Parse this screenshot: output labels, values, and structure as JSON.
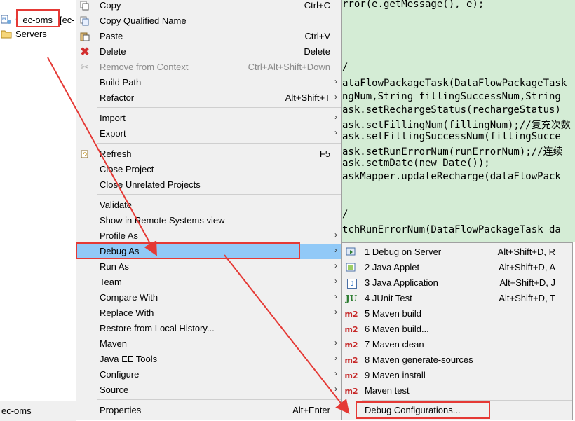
{
  "explorer": {
    "project_name": "ec-oms",
    "project_suffix": "[ec-",
    "servers_label": "Servers",
    "status_text": "ec-oms"
  },
  "editor": {
    "lines": [
      {
        "pre": "",
        "parts": [
          [
            "t",
            "rror(e.getMessage(), e);"
          ]
        ]
      },
      {
        "pre": "",
        "parts": [
          [
            "t",
            "/"
          ]
        ]
      },
      {
        "pre": "",
        "parts": [
          [
            "t",
            "ataFlowPackageTask(DataFlowPackageTask"
          ]
        ]
      },
      {
        "pre": "",
        "parts": [
          [
            "t",
            "ngNum,String fillingSuccessNum,String"
          ]
        ]
      },
      {
        "pre": "",
        "parts": [
          [
            "t",
            "ask.setRechargeStatus(rechargeStatus)"
          ]
        ]
      },
      {
        "pre": "",
        "parts": [
          [
            "t",
            "ask.setFillingNum(fillingNum);//复充次数"
          ]
        ]
      },
      {
        "pre": "",
        "parts": [
          [
            "t",
            "ask.setFillingSuccessNum(fillingSucce"
          ]
        ]
      },
      {
        "pre": "",
        "parts": [
          [
            "t",
            "ask.setRunErrorNum(runErrorNum);//连续"
          ]
        ]
      },
      {
        "pre": "",
        "parts": [
          [
            "t",
            "ask.setmDate(new Date());"
          ]
        ]
      },
      {
        "pre": "",
        "parts": [
          [
            "t",
            "askMapper.updateRecharge(dataFlowPack"
          ]
        ]
      },
      {
        "pre": "",
        "parts": [
          [
            "t",
            "/"
          ]
        ]
      },
      {
        "pre": "",
        "parts": [
          [
            "t",
            "tchRunErrorNum(DataFlowPackageTask da"
          ]
        ]
      }
    ]
  },
  "menu": {
    "items": [
      {
        "label": "Copy",
        "shortcut": "Ctrl+C",
        "icon": "copy-icon"
      },
      {
        "label": "Copy Qualified Name",
        "shortcut": "",
        "icon": "copy-qualified-icon"
      },
      {
        "label": "Paste",
        "shortcut": "Ctrl+V",
        "icon": "paste-icon"
      },
      {
        "label": "Delete",
        "shortcut": "Delete",
        "icon": "delete-icon"
      },
      {
        "label": "Remove from Context",
        "shortcut": "Ctrl+Alt+Shift+Down",
        "icon": "remove-context-icon"
      },
      {
        "label": "Build Path",
        "shortcut": "",
        "icon": ""
      },
      {
        "label": "Refactor",
        "shortcut": "Alt+Shift+T",
        "icon": ""
      },
      {
        "label": "Import",
        "shortcut": "",
        "icon": ""
      },
      {
        "label": "Export",
        "shortcut": "",
        "icon": ""
      },
      {
        "label": "Refresh",
        "shortcut": "F5",
        "icon": "refresh-icon"
      },
      {
        "label": "Close Project",
        "shortcut": "",
        "icon": ""
      },
      {
        "label": "Close Unrelated Projects",
        "shortcut": "",
        "icon": ""
      },
      {
        "label": "Validate",
        "shortcut": "",
        "icon": ""
      },
      {
        "label": "Show in Remote Systems view",
        "shortcut": "",
        "icon": ""
      },
      {
        "label": "Profile As",
        "shortcut": "",
        "icon": ""
      },
      {
        "label": "Debug As",
        "shortcut": "",
        "icon": ""
      },
      {
        "label": "Run As",
        "shortcut": "",
        "icon": ""
      },
      {
        "label": "Team",
        "shortcut": "",
        "icon": ""
      },
      {
        "label": "Compare With",
        "shortcut": "",
        "icon": ""
      },
      {
        "label": "Replace With",
        "shortcut": "",
        "icon": ""
      },
      {
        "label": "Restore from Local History...",
        "shortcut": "",
        "icon": ""
      },
      {
        "label": "Maven",
        "shortcut": "",
        "icon": ""
      },
      {
        "label": "Java EE Tools",
        "shortcut": "",
        "icon": ""
      },
      {
        "label": "Configure",
        "shortcut": "",
        "icon": ""
      },
      {
        "label": "Source",
        "shortcut": "",
        "icon": ""
      },
      {
        "label": "Properties",
        "shortcut": "Alt+Enter",
        "icon": ""
      }
    ]
  },
  "submenu": {
    "items": [
      {
        "label": "1 Debug on Server",
        "shortcut": "Alt+Shift+D, R",
        "icon": "debug-server-icon"
      },
      {
        "label": "2 Java Applet",
        "shortcut": "Alt+Shift+D, A",
        "icon": "java-applet-icon"
      },
      {
        "label": "3 Java Application",
        "shortcut": "Alt+Shift+D, J",
        "icon": "java-application-icon"
      },
      {
        "label": "4 JUnit Test",
        "shortcut": "Alt+Shift+D, T",
        "icon": "junit-icon"
      },
      {
        "label": "5 Maven build",
        "shortcut": "",
        "icon": "maven-icon"
      },
      {
        "label": "6 Maven build...",
        "shortcut": "",
        "icon": "maven-icon"
      },
      {
        "label": "7 Maven clean",
        "shortcut": "",
        "icon": "maven-icon"
      },
      {
        "label": "8 Maven generate-sources",
        "shortcut": "",
        "icon": "maven-icon"
      },
      {
        "label": "9 Maven install",
        "shortcut": "",
        "icon": "maven-icon"
      },
      {
        "label": "Maven test",
        "shortcut": "",
        "icon": "maven-icon"
      },
      {
        "label": "Debug Configurations...",
        "shortcut": "",
        "icon": ""
      }
    ],
    "maven_icon_text": "m2",
    "junit_icon_text": "JU",
    "java_icon_text": "J"
  },
  "colors": {
    "highlight": "#91c9f7",
    "annotation_red": "#e53935",
    "menu_bg": "#f0f0f0",
    "editor_bg": "#d4ecd5"
  }
}
